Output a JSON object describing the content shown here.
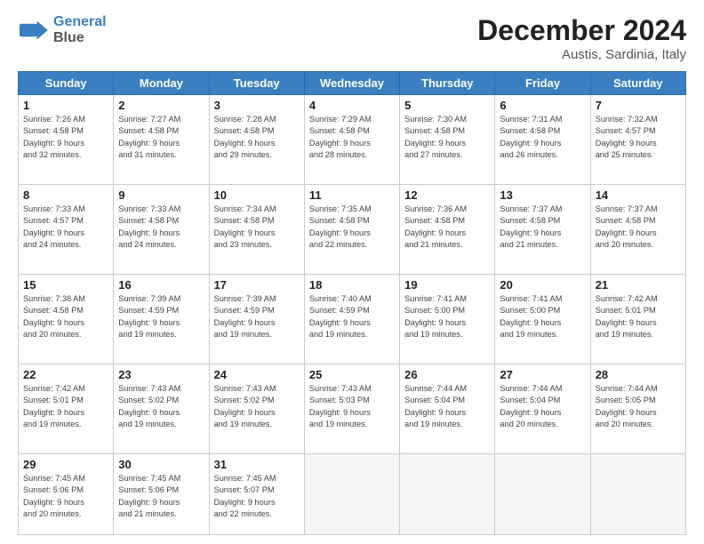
{
  "header": {
    "logo_text_1": "General",
    "logo_text_2": "Blue",
    "month": "December 2024",
    "location": "Austis, Sardinia, Italy"
  },
  "weekdays": [
    "Sunday",
    "Monday",
    "Tuesday",
    "Wednesday",
    "Thursday",
    "Friday",
    "Saturday"
  ],
  "days": [
    {
      "num": "",
      "info": ""
    },
    {
      "num": "",
      "info": ""
    },
    {
      "num": "",
      "info": ""
    },
    {
      "num": "",
      "info": ""
    },
    {
      "num": "",
      "info": ""
    },
    {
      "num": "",
      "info": ""
    },
    {
      "num": "",
      "info": ""
    },
    {
      "num": "1",
      "info": "Sunrise: 7:26 AM\nSunset: 4:58 PM\nDaylight: 9 hours\nand 32 minutes."
    },
    {
      "num": "2",
      "info": "Sunrise: 7:27 AM\nSunset: 4:58 PM\nDaylight: 9 hours\nand 31 minutes."
    },
    {
      "num": "3",
      "info": "Sunrise: 7:28 AM\nSunset: 4:58 PM\nDaylight: 9 hours\nand 29 minutes."
    },
    {
      "num": "4",
      "info": "Sunrise: 7:29 AM\nSunset: 4:58 PM\nDaylight: 9 hours\nand 28 minutes."
    },
    {
      "num": "5",
      "info": "Sunrise: 7:30 AM\nSunset: 4:58 PM\nDaylight: 9 hours\nand 27 minutes."
    },
    {
      "num": "6",
      "info": "Sunrise: 7:31 AM\nSunset: 4:58 PM\nDaylight: 9 hours\nand 26 minutes."
    },
    {
      "num": "7",
      "info": "Sunrise: 7:32 AM\nSunset: 4:57 PM\nDaylight: 9 hours\nand 25 minutes."
    },
    {
      "num": "8",
      "info": "Sunrise: 7:33 AM\nSunset: 4:57 PM\nDaylight: 9 hours\nand 24 minutes."
    },
    {
      "num": "9",
      "info": "Sunrise: 7:33 AM\nSunset: 4:58 PM\nDaylight: 9 hours\nand 24 minutes."
    },
    {
      "num": "10",
      "info": "Sunrise: 7:34 AM\nSunset: 4:58 PM\nDaylight: 9 hours\nand 23 minutes."
    },
    {
      "num": "11",
      "info": "Sunrise: 7:35 AM\nSunset: 4:58 PM\nDaylight: 9 hours\nand 22 minutes."
    },
    {
      "num": "12",
      "info": "Sunrise: 7:36 AM\nSunset: 4:58 PM\nDaylight: 9 hours\nand 21 minutes."
    },
    {
      "num": "13",
      "info": "Sunrise: 7:37 AM\nSunset: 4:58 PM\nDaylight: 9 hours\nand 21 minutes."
    },
    {
      "num": "14",
      "info": "Sunrise: 7:37 AM\nSunset: 4:58 PM\nDaylight: 9 hours\nand 20 minutes."
    },
    {
      "num": "15",
      "info": "Sunrise: 7:38 AM\nSunset: 4:58 PM\nDaylight: 9 hours\nand 20 minutes."
    },
    {
      "num": "16",
      "info": "Sunrise: 7:39 AM\nSunset: 4:59 PM\nDaylight: 9 hours\nand 19 minutes."
    },
    {
      "num": "17",
      "info": "Sunrise: 7:39 AM\nSunset: 4:59 PM\nDaylight: 9 hours\nand 19 minutes."
    },
    {
      "num": "18",
      "info": "Sunrise: 7:40 AM\nSunset: 4:59 PM\nDaylight: 9 hours\nand 19 minutes."
    },
    {
      "num": "19",
      "info": "Sunrise: 7:41 AM\nSunset: 5:00 PM\nDaylight: 9 hours\nand 19 minutes."
    },
    {
      "num": "20",
      "info": "Sunrise: 7:41 AM\nSunset: 5:00 PM\nDaylight: 9 hours\nand 19 minutes."
    },
    {
      "num": "21",
      "info": "Sunrise: 7:42 AM\nSunset: 5:01 PM\nDaylight: 9 hours\nand 19 minutes."
    },
    {
      "num": "22",
      "info": "Sunrise: 7:42 AM\nSunset: 5:01 PM\nDaylight: 9 hours\nand 19 minutes."
    },
    {
      "num": "23",
      "info": "Sunrise: 7:43 AM\nSunset: 5:02 PM\nDaylight: 9 hours\nand 19 minutes."
    },
    {
      "num": "24",
      "info": "Sunrise: 7:43 AM\nSunset: 5:02 PM\nDaylight: 9 hours\nand 19 minutes."
    },
    {
      "num": "25",
      "info": "Sunrise: 7:43 AM\nSunset: 5:03 PM\nDaylight: 9 hours\nand 19 minutes."
    },
    {
      "num": "26",
      "info": "Sunrise: 7:44 AM\nSunset: 5:04 PM\nDaylight: 9 hours\nand 19 minutes."
    },
    {
      "num": "27",
      "info": "Sunrise: 7:44 AM\nSunset: 5:04 PM\nDaylight: 9 hours\nand 20 minutes."
    },
    {
      "num": "28",
      "info": "Sunrise: 7:44 AM\nSunset: 5:05 PM\nDaylight: 9 hours\nand 20 minutes."
    },
    {
      "num": "29",
      "info": "Sunrise: 7:45 AM\nSunset: 5:06 PM\nDaylight: 9 hours\nand 20 minutes."
    },
    {
      "num": "30",
      "info": "Sunrise: 7:45 AM\nSunset: 5:06 PM\nDaylight: 9 hours\nand 21 minutes."
    },
    {
      "num": "31",
      "info": "Sunrise: 7:45 AM\nSunset: 5:07 PM\nDaylight: 9 hours\nand 22 minutes."
    },
    {
      "num": "",
      "info": ""
    },
    {
      "num": "",
      "info": ""
    },
    {
      "num": "",
      "info": ""
    },
    {
      "num": "",
      "info": ""
    },
    {
      "num": "",
      "info": ""
    }
  ]
}
